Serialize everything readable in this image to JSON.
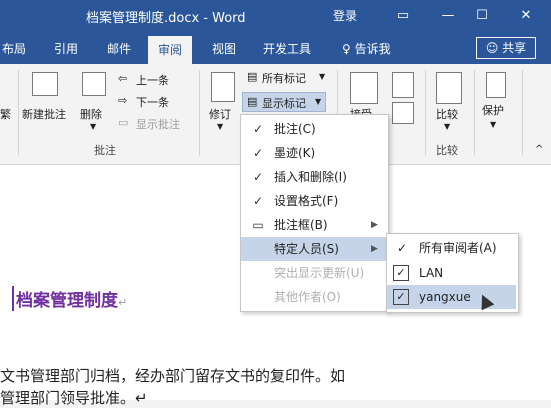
{
  "window": {
    "title": "档案管理制度.docx - Word",
    "login": "登录",
    "minimize": "—",
    "restore": "☐",
    "close": "✕"
  },
  "tabs": [
    "布局",
    "引用",
    "邮件",
    "审阅",
    "视图",
    "开发工具"
  ],
  "active_tab": "审阅",
  "tellme": "告诉我",
  "share": "共享",
  "ribbon": {
    "comments": {
      "new": "新建批注",
      "delete": "删除",
      "prev": "上一条",
      "next": "下一条",
      "show": "显示批注",
      "group": "批注"
    },
    "tracking": {
      "track": "修订",
      "all_markup": "所有标记",
      "show_markup": "显示标记"
    },
    "accept": "接受",
    "compare": "比较",
    "compare_group": "比较",
    "protect": "保护",
    "left_cut": "繁"
  },
  "menu": {
    "items": [
      {
        "label": "批注(C)",
        "checked": true
      },
      {
        "label": "墨迹(K)",
        "checked": true
      },
      {
        "label": "插入和删除(I)",
        "checked": true
      },
      {
        "label": "设置格式(F)",
        "checked": true
      },
      {
        "label": "批注框(B)",
        "checked": false,
        "submenu": true
      },
      {
        "label": "特定人员(S)",
        "checked": false,
        "submenu": true,
        "highlighted": true
      },
      {
        "label": "突出显示更新(U)",
        "disabled": true
      },
      {
        "label": "其他作者(O)",
        "disabled": true
      }
    ]
  },
  "submenu": {
    "items": [
      {
        "label": "所有审阅者(A)",
        "checked": true
      },
      {
        "label": "LAN",
        "checked": true
      },
      {
        "label": "yangxue",
        "checked": true,
        "highlighted": true
      }
    ]
  },
  "document": {
    "heading": "档案管理制度",
    "heading_mark": "↵",
    "line1": "文书管理部门归档，经办部门留存文书的复印件。如",
    "line2": "管理部门领导批准。↵"
  }
}
